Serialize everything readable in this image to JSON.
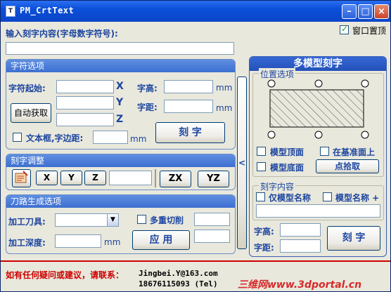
{
  "window": {
    "title": "PM_CrtText",
    "icon": "app-icon",
    "minimize": "–",
    "maximize": "□",
    "close": "×"
  },
  "top": {
    "prompt": "输入刻字内容(字母数字符号):",
    "topmost_label": "窗口置顶",
    "topmost_checked": true,
    "text_value": ""
  },
  "char_options": {
    "header": "字符选项",
    "start_label": "字符起始:",
    "axis_x": "X",
    "axis_y": "Y",
    "axis_z": "Z",
    "auto_button": "自动获取",
    "height_label": "字高:",
    "height_unit": "mm",
    "spacing_label": "字距:",
    "spacing_unit": "mm",
    "textbox_label": "文本框,字边距:",
    "textbox_unit": "mm",
    "engrave_button": "刻  字"
  },
  "adjust": {
    "header": "刻字调整",
    "icon": "engrave-tool-icon",
    "x": "X",
    "y": "Y",
    "z": "Z",
    "zx": "ZX",
    "yz": "YZ"
  },
  "toolpath": {
    "header": "刀路生成选项",
    "tool_label": "加工刀具:",
    "multi_cut_label": "多重切削",
    "depth_label": "加工深度:",
    "depth_unit": "mm",
    "apply_button": "应 用"
  },
  "collapse_button": "<",
  "multi_model": {
    "header": "多模型刻字",
    "position_legend": "位置选项",
    "model_top": "模型顶面",
    "model_bottom": "模型底面",
    "on_base": "在基准面上",
    "pick_button": "点拾取",
    "content_legend": "刻字内容",
    "model_name_only": "仅模型名称",
    "model_name_plus": "模型名称 +",
    "height_label": "字高:",
    "spacing_label": "字距:",
    "engrave_button": "刻  字"
  },
  "footer": {
    "contact": "如有任何疑问或建议，请联系：",
    "email": "Jingbei.Y@163.com",
    "phone": "18676115093 (Tel)",
    "watermark": "三维网www.3dportal.cn"
  }
}
